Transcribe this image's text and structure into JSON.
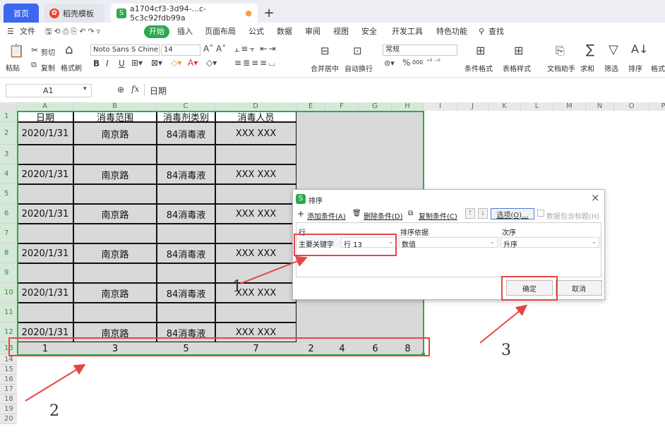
{
  "tabs": {
    "home": "首页",
    "daoke": "稻壳模板",
    "file": "a1704cf3-3d94-...c-5c3c92fdb99a",
    "file_icon": "S",
    "plus": "+",
    "unsaved_dot": "●"
  },
  "menu": {
    "file": "文件",
    "start": "开始",
    "insert": "插入",
    "layout": "页面布局",
    "formula": "公式",
    "data": "数据",
    "review": "审阅",
    "view": "视图",
    "security": "安全",
    "dev": "开发工具",
    "special": "特色功能",
    "search": "查找"
  },
  "ribbon": {
    "paste": "粘贴",
    "cut": "剪切",
    "copy": "复制",
    "format_painter": "格式刷",
    "font_name": "Noto Sans S Chine",
    "font_size": "14",
    "bold": "B",
    "italic": "I",
    "underline": "U",
    "merge": "合并居中",
    "wrap": "自动换行",
    "num_format": "常规",
    "percent": "%",
    "thousands": "000",
    "cond_format": "条件格式",
    "table_style": "表格样式",
    "doc_helper": "文档助手",
    "sum": "求和",
    "filter": "筛选",
    "sort": "排序",
    "more": "格式"
  },
  "formula_bar": {
    "cell_ref": "A1",
    "fx": "fx",
    "content": "日期"
  },
  "columns": [
    "A",
    "B",
    "C",
    "D",
    "E",
    "F",
    "G",
    "H",
    "I",
    "J",
    "K",
    "L",
    "M",
    "N",
    "O",
    "P"
  ],
  "rows": [
    "1",
    "2",
    "3",
    "4",
    "5",
    "6",
    "7",
    "8",
    "9",
    "10",
    "11",
    "12",
    "13",
    "14",
    "15",
    "16",
    "17",
    "18",
    "19",
    "20"
  ],
  "table": {
    "headers": [
      "日期",
      "消毒范围",
      "消毒剂类别",
      "消毒人员"
    ],
    "record": [
      "2020/1/31",
      "南京路",
      "84消毒液",
      "XXX XXX"
    ],
    "row13": [
      "1",
      "3",
      "5",
      "7",
      "2",
      "4",
      "6",
      "8"
    ]
  },
  "dialog": {
    "title": "排序",
    "icon": "S",
    "close": "×",
    "add": "添加条件(A)",
    "delete": "删除条件(D)",
    "copy": "复制条件(C)",
    "up": "↑",
    "down": "↓",
    "options": "选项(O)...",
    "header_check": "数据包含标题(H)",
    "col_row": "行",
    "col_basis": "排序依据",
    "col_order": "次序",
    "key_label": "主要关键字",
    "key_value": "行 13",
    "basis_value": "数值",
    "order_value": "升序",
    "ok": "确定",
    "cancel": "取消"
  },
  "annotations": [
    "1",
    "2",
    "3"
  ],
  "colors": {
    "accent": "#3c67f0",
    "start_green": "#2fa84f",
    "selection": "#2e8b3e",
    "annotation_red": "#e64545"
  }
}
